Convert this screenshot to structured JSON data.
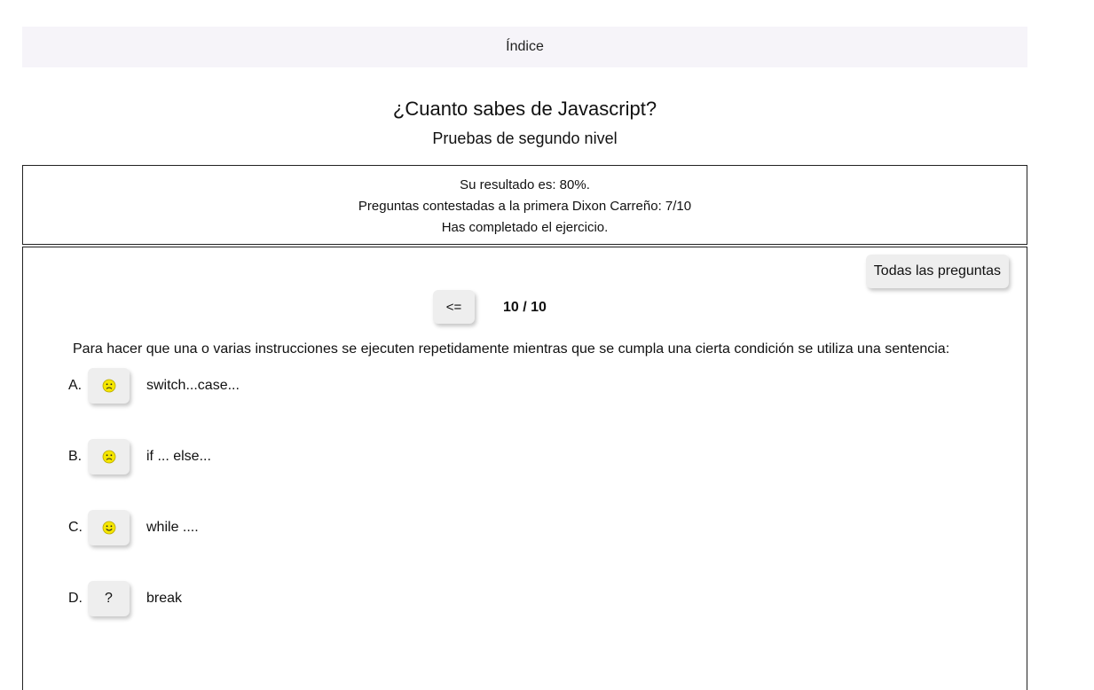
{
  "nav": {
    "index_label": "Índice"
  },
  "header": {
    "title": "¿Cuanto sabes de Javascript?",
    "subtitle": "Pruebas de segundo nivel"
  },
  "result": {
    "line1": "Su resultado es: 80%.",
    "line2": "Preguntas contestadas a la primera Dixon Carreño: 7/10",
    "line3": "Has completado el ejercicio."
  },
  "quiz": {
    "all_questions_label": "Todas las preguntas",
    "prev_label": "<=",
    "counter": "10 / 10",
    "question": "Para hacer que una o varias instrucciones se ejecuten repetidamente mientras que se cumpla una cierta condición se utiliza una sentencia:",
    "options": [
      {
        "letter": "A.",
        "state": "sad-face-icon",
        "text": "switch...case..."
      },
      {
        "letter": "B.",
        "state": "sad-face-icon",
        "text": "if ... else..."
      },
      {
        "letter": "C.",
        "state": "happy-face-icon",
        "text": "while ...."
      },
      {
        "letter": "D.",
        "mark": "?",
        "text": "break"
      }
    ]
  },
  "colors": {
    "index_bar_bg": "#f6f4f9",
    "button_bg": "#eeeeee",
    "face_yellow": "#f5e600"
  }
}
